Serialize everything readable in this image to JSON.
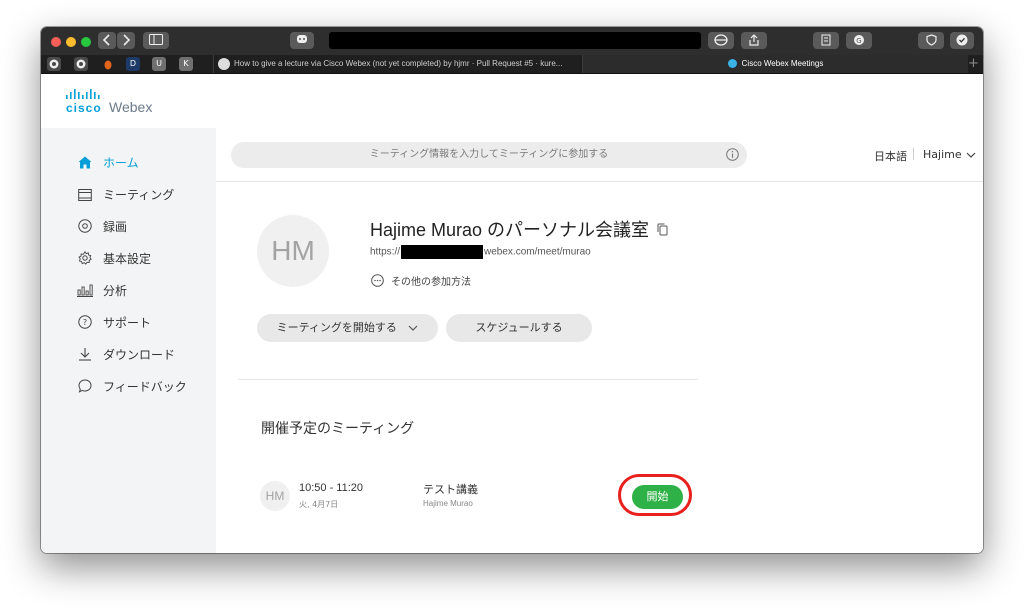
{
  "browser": {
    "tabs": [
      {
        "label": "How to give a lecture via Cisco Webex (not yet completed) by hjmr · Pull Request #5 · kure..."
      },
      {
        "label": "Cisco Webex Meetings"
      }
    ],
    "pinned_tabs": [
      "github-icon",
      "github-icon",
      "shield-icon",
      "D",
      "U",
      "K"
    ]
  },
  "header": {
    "logo_cisco": "cisco",
    "logo_webex": "Webex"
  },
  "sidebar": {
    "items": [
      {
        "label": "ホーム",
        "icon": "home-icon"
      },
      {
        "label": "ミーティング",
        "icon": "calendar-icon"
      },
      {
        "label": "録画",
        "icon": "record-icon"
      },
      {
        "label": "基本設定",
        "icon": "gear-icon"
      },
      {
        "label": "分析",
        "icon": "analytics-icon"
      },
      {
        "label": "サポート",
        "icon": "help-icon"
      },
      {
        "label": "ダウンロード",
        "icon": "download-icon"
      },
      {
        "label": "フィードバック",
        "icon": "feedback-icon"
      }
    ]
  },
  "topbar": {
    "search_placeholder": "ミーティング情報を入力してミーティングに参加する",
    "language": "日本語",
    "user": "Hajime"
  },
  "room": {
    "initials": "HM",
    "title": "Hajime Murao のパーソナル会議室",
    "url_prefix": "https://",
    "url_suffix": "webex.com/meet/murao",
    "other_join": "その他の参加方法",
    "start_button": "ミーティングを開始する",
    "schedule_button": "スケジュールする"
  },
  "upcoming": {
    "title": "開催予定のミーティング",
    "meetings": [
      {
        "initials": "HM",
        "time": "10:50 - 11:20",
        "date": "火, 4月7日",
        "title": "テスト講義",
        "host": "Hajime Murao",
        "start_label": "開始"
      }
    ]
  },
  "colors": {
    "accent": "#049fd9",
    "start_green": "#2eb146",
    "highlight_red": "#e8201e"
  }
}
